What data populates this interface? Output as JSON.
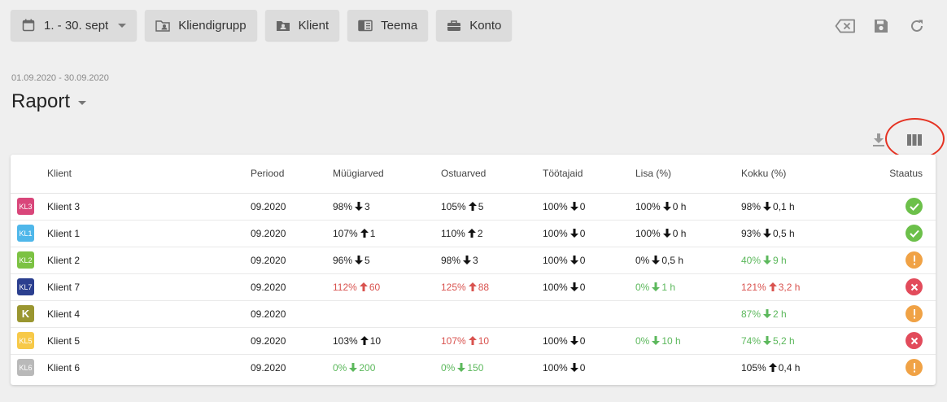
{
  "toolbar": {
    "period": {
      "label": "1. - 30. sept",
      "icon": "calendar-icon"
    },
    "buttons": [
      {
        "label": "Kliendigrupp",
        "icon": "client-group-icon"
      },
      {
        "label": "Klient",
        "icon": "client-icon"
      },
      {
        "label": "Teema",
        "icon": "theme-icon"
      },
      {
        "label": "Konto",
        "icon": "briefcase-icon"
      }
    ],
    "right_icons": [
      "clear-filter-icon",
      "save-icon",
      "refresh-icon"
    ]
  },
  "header": {
    "date_range": "01.09.2020 - 30.09.2020",
    "title": "Raport"
  },
  "table_tools": {
    "download_icon": "download-icon",
    "columns_icon": "columns-icon",
    "highlight_color": "#e53222"
  },
  "table": {
    "columns": [
      "Klient",
      "Periood",
      "Müügiarved",
      "Ostuarved",
      "Töötajaid",
      "Lisa (%)",
      "Kokku (%)",
      "Staatus"
    ],
    "rows": [
      {
        "badge": "KL3",
        "badge_color": "#d9467a",
        "name": "Klient 3",
        "period": "09.2020",
        "cells": [
          {
            "pct": "98%",
            "dir": "down",
            "val": "3",
            "tone": "neutral"
          },
          {
            "pct": "105%",
            "dir": "up",
            "val": "5",
            "tone": "neutral"
          },
          {
            "pct": "100%",
            "dir": "down",
            "val": "0",
            "tone": "neutral"
          },
          {
            "pct": "100%",
            "dir": "down",
            "val": "0 h",
            "tone": "neutral"
          },
          {
            "pct": "98%",
            "dir": "down",
            "val": "0,1 h",
            "tone": "neutral"
          }
        ],
        "status": "ok"
      },
      {
        "badge": "KL1",
        "badge_color": "#4fb7ea",
        "name": "Klient 1",
        "period": "09.2020",
        "cells": [
          {
            "pct": "107%",
            "dir": "up",
            "val": "1",
            "tone": "neutral"
          },
          {
            "pct": "110%",
            "dir": "up",
            "val": "2",
            "tone": "neutral"
          },
          {
            "pct": "100%",
            "dir": "down",
            "val": "0",
            "tone": "neutral"
          },
          {
            "pct": "100%",
            "dir": "down",
            "val": "0 h",
            "tone": "neutral"
          },
          {
            "pct": "93%",
            "dir": "down",
            "val": "0,5 h",
            "tone": "neutral"
          }
        ],
        "status": "ok"
      },
      {
        "badge": "KL2",
        "badge_color": "#7cc243",
        "name": "Klient 2",
        "period": "09.2020",
        "cells": [
          {
            "pct": "96%",
            "dir": "down",
            "val": "5",
            "tone": "neutral"
          },
          {
            "pct": "98%",
            "dir": "down",
            "val": "3",
            "tone": "neutral"
          },
          {
            "pct": "100%",
            "dir": "down",
            "val": "0",
            "tone": "neutral"
          },
          {
            "pct": "0%",
            "dir": "down",
            "val": "0,5 h",
            "tone": "neutral"
          },
          {
            "pct": "40%",
            "dir": "down",
            "val": "9 h",
            "tone": "good"
          }
        ],
        "status": "warn"
      },
      {
        "badge": "KL7",
        "badge_color": "#2b3f8f",
        "name": "Klient 7",
        "period": "09.2020",
        "cells": [
          {
            "pct": "112%",
            "dir": "up",
            "val": "60",
            "tone": "bad"
          },
          {
            "pct": "125%",
            "dir": "up",
            "val": "88",
            "tone": "bad"
          },
          {
            "pct": "100%",
            "dir": "down",
            "val": "0",
            "tone": "neutral"
          },
          {
            "pct": "0%",
            "dir": "down",
            "val": "1 h",
            "tone": "good"
          },
          {
            "pct": "121%",
            "dir": "up",
            "val": "3,2 h",
            "tone": "bad"
          }
        ],
        "status": "err"
      },
      {
        "badge": "K",
        "badge_color": "#9a9630",
        "name": "Klient 4",
        "period": "09.2020",
        "cells": [
          null,
          null,
          null,
          null,
          {
            "pct": "87%",
            "dir": "down",
            "val": "2 h",
            "tone": "good"
          }
        ],
        "status": "warn"
      },
      {
        "badge": "KL5",
        "badge_color": "#f7c948",
        "name": "Klient 5",
        "period": "09.2020",
        "cells": [
          {
            "pct": "103%",
            "dir": "up",
            "val": "10",
            "tone": "neutral"
          },
          {
            "pct": "107%",
            "dir": "up",
            "val": "10",
            "tone": "bad"
          },
          {
            "pct": "100%",
            "dir": "down",
            "val": "0",
            "tone": "neutral"
          },
          {
            "pct": "0%",
            "dir": "down",
            "val": "10 h",
            "tone": "good"
          },
          {
            "pct": "74%",
            "dir": "down",
            "val": "5,2 h",
            "tone": "good"
          }
        ],
        "status": "err"
      },
      {
        "badge": "KL6",
        "badge_color": "#b9b9b9",
        "name": "Klient 6",
        "period": "09.2020",
        "cells": [
          {
            "pct": "0%",
            "dir": "down",
            "val": "200",
            "tone": "good"
          },
          {
            "pct": "0%",
            "dir": "down",
            "val": "150",
            "tone": "good"
          },
          {
            "pct": "100%",
            "dir": "down",
            "val": "0",
            "tone": "neutral"
          },
          null,
          {
            "pct": "105%",
            "dir": "up",
            "val": "0,4 h",
            "tone": "neutral"
          }
        ],
        "status": "warn"
      }
    ]
  }
}
